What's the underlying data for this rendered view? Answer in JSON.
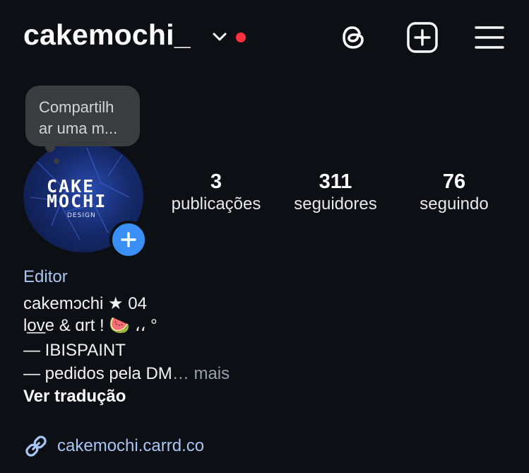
{
  "header": {
    "username": "cakemochi_",
    "icons": [
      "chevron-down-icon",
      "threads-icon",
      "add-post-icon",
      "menu-icon"
    ],
    "notification_dot_color": "#ff3040"
  },
  "tooltip": {
    "text": "Compartilh\nar uma m..."
  },
  "profile": {
    "avatar_logo_top": "CAKE",
    "avatar_logo_bottom": "MOCHI",
    "avatar_logo_sub": "DESIGN"
  },
  "stats": [
    {
      "value": "3",
      "label": "publicações"
    },
    {
      "value": "311",
      "label": "seguidores"
    },
    {
      "value": "76",
      "label": "seguindo"
    }
  ],
  "bio": {
    "category": "Editor",
    "name_line": "cakemɔchi ★ 04",
    "line2": "lo̲v̲e & ɑrt ! 🍉 ،، °",
    "line3": "— IBISPAINT",
    "line4": "— pedidos pela DM",
    "more": "… mais",
    "see_translation": "Ver tradução",
    "link": "cakemochi.carrd.co"
  },
  "colors": {
    "accent_link": "#a7c6f4",
    "add_badge": "#3a8ff7",
    "background": "#0c0f14"
  }
}
